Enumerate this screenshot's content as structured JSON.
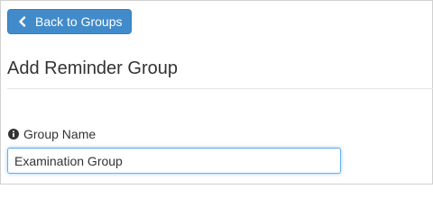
{
  "toolbar": {
    "back_label": "Back to Groups"
  },
  "page": {
    "title": "Add Reminder Group"
  },
  "form": {
    "group_name_label": "Group Name",
    "group_name_value": "Examination Group"
  },
  "icons": {
    "back": "chevron-left-icon",
    "label_info": "info-circle-icon"
  },
  "colors": {
    "primary_button": "#428bca",
    "input_focus_border": "#66afe9"
  }
}
